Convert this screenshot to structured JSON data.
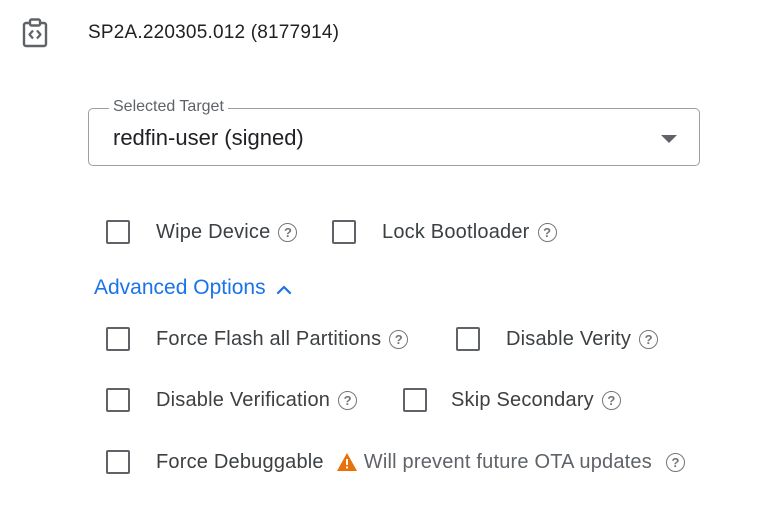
{
  "build": {
    "icon": "build-code-icon",
    "title": "SP2A.220305.012 (8177914)"
  },
  "target_select": {
    "label": "Selected Target",
    "value": "redfin-user (signed)",
    "icon": "dropdown-arrow-icon"
  },
  "options": {
    "wipe_device": {
      "label": "Wipe Device",
      "checked": false
    },
    "lock_bootloader": {
      "label": "Lock Bootloader",
      "checked": false
    }
  },
  "advanced": {
    "label": "Advanced Options",
    "expanded": true,
    "icon": "chevron-up-icon",
    "options": {
      "force_flash": {
        "label": "Force Flash all Partitions",
        "checked": false
      },
      "disable_verity": {
        "label": "Disable Verity",
        "checked": false
      },
      "disable_verification": {
        "label": "Disable Verification",
        "checked": false
      },
      "skip_secondary": {
        "label": "Skip Secondary",
        "checked": false
      },
      "force_debuggable": {
        "label": "Force Debuggable",
        "checked": false
      }
    },
    "warning": {
      "icon": "warning-icon",
      "text": "Will prevent future OTA updates"
    }
  },
  "help_glyph": "?",
  "colors": {
    "accent": "#1a73e8",
    "warning": "#e8710a",
    "text": "#202124",
    "secondary_text": "#5f6368",
    "border": "#9aa0a6"
  }
}
